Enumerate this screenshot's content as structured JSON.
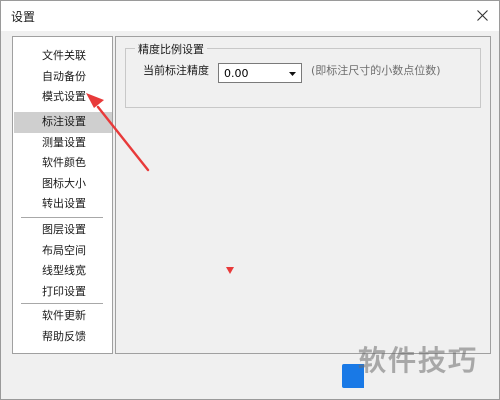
{
  "window": {
    "title": "设置"
  },
  "sidebar": {
    "groups": [
      {
        "items": [
          {
            "label": "文件关联",
            "selected": false
          },
          {
            "label": "自动备份",
            "selected": false
          },
          {
            "label": "模式设置",
            "selected": false
          }
        ]
      },
      {
        "items": [
          {
            "label": "标注设置",
            "selected": true
          },
          {
            "label": "测量设置",
            "selected": false
          },
          {
            "label": "软件颜色",
            "selected": false
          },
          {
            "label": "图标大小",
            "selected": false
          },
          {
            "label": "转出设置",
            "selected": false
          }
        ]
      },
      {
        "items": [
          {
            "label": "图层设置",
            "selected": false
          },
          {
            "label": "布局空间",
            "selected": false
          },
          {
            "label": "线型线宽",
            "selected": false
          },
          {
            "label": "打印设置",
            "selected": false
          }
        ]
      },
      {
        "items": [
          {
            "label": "软件更新",
            "selected": false
          },
          {
            "label": "帮助反馈",
            "selected": false
          }
        ]
      }
    ]
  },
  "panel": {
    "group_title": "精度比例设置",
    "precision_label": "当前标注精度",
    "precision_value": "0.00",
    "precision_hint": "(即标注尺寸的小数点位数)"
  },
  "watermark": {
    "text": "软件技巧"
  },
  "colors": {
    "annotation_arrow": "#e83a3a",
    "selected_item_bg": "#cfcfcf",
    "accent_button": "#1979e6"
  },
  "icons": {
    "close": "close-icon",
    "dropdown": "chevron-down-icon",
    "arrow": "red-arrow-annotation",
    "cursor": "triangle-cursor-icon"
  }
}
